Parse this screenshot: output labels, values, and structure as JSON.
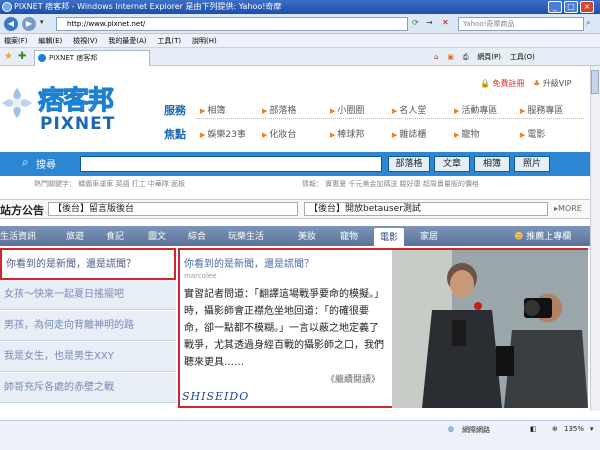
{
  "window": {
    "title": "PIXNET 痞客邦 - Windows Internet Explorer 是由下列提供: Yahoo!奇摩"
  },
  "browser": {
    "address": "http://www.pixnet.net/",
    "search_placeholder": "Yahoo!奇摩商品",
    "menu": [
      "檔案(F)",
      "編輯(E)",
      "檢視(V)",
      "我的最愛(A)",
      "工具(T)",
      "說明(H)"
    ],
    "tab_title": "PIXNET 痞客邦",
    "toolbar": {
      "register": "免費註冊",
      "vip": "升級VIP",
      "page": "網頁(P)",
      "tools": "工具(O)"
    },
    "status": {
      "zone": "網際網路",
      "zoom": "135%"
    }
  },
  "site": {
    "logo_cn": "痞客邦",
    "logo_en": "PIXNET",
    "nav_rows": [
      {
        "category": "服務",
        "items": [
          "相簿",
          "部落格",
          "小圈圈",
          "名人堂",
          "活動專區",
          "服務專區"
        ]
      },
      {
        "category": "焦點",
        "items": [
          "娛樂23事",
          "化妝台",
          "棒球邦",
          "雜誌櫃",
          "寵物",
          "電影"
        ]
      }
    ],
    "search": {
      "label": "搜尋",
      "buttons": [
        "部落格",
        "文章",
        "相簿",
        "照片"
      ]
    },
    "hot": {
      "left": "熱門關鍵字： 轎霸車運車 英語 打工 中華隊 面板",
      "right": "情報： 實惠夏 千元美金加碼送 駿好康 超周賣量販的價格"
    },
    "announcement": {
      "title": "站方公告",
      "items": [
        "【後台】留言版後台",
        "【後台】開放betauser測試"
      ],
      "more": "MORE"
    },
    "categories": [
      "生活資訊",
      "旅遊",
      "食記",
      "圖文",
      "綜合",
      "玩樂生活",
      "美妝",
      "寵物",
      "電影",
      "家居"
    ],
    "active_category": "電影",
    "recommend": "推薦上專欄",
    "left_list": [
      "你看到的是新聞，還是謊聞？",
      "女孩～快來一起夏日搖擺吧",
      "男孩，為何走向背離神明的路",
      "我是女生，也是男生XXY",
      "帥哥充斥各處的赤壁之戰"
    ],
    "feature": {
      "title": "你看到的是新聞，還是謊聞？",
      "author": "marcolee",
      "body": "實習記者問道：「翻譯這場戰爭要命的模擬。」時，攝影師會正襟危坐地回道：「的確很要命，卻一點都不模糊。」一言以蔽之地定義了戰爭，尤其透過身經百戰的攝影師之口，我們聽來更具……",
      "read_more": "《繼續閱讀》",
      "brand": "SHISEIDO"
    }
  }
}
